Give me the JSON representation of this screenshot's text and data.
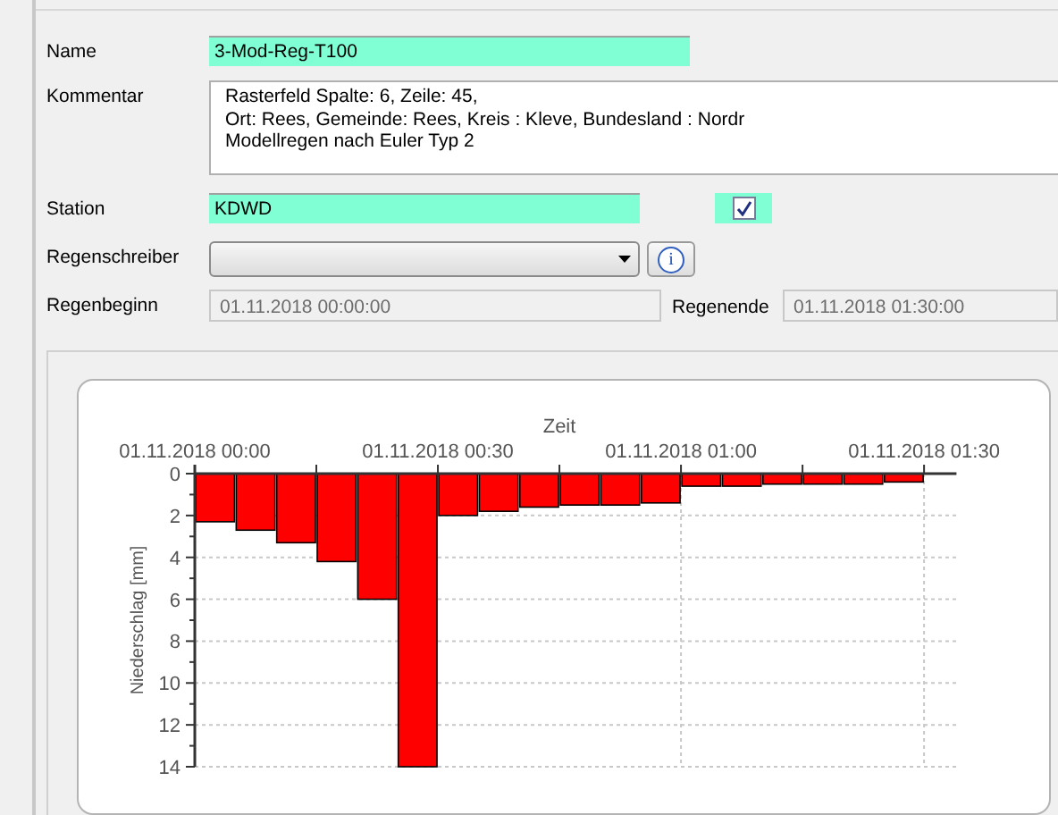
{
  "fields": [
    {
      "kind": "text",
      "label": "Name",
      "value": "3-Mod-Reg-T100",
      "highlighted": true
    },
    {
      "kind": "memo",
      "label": "Kommentar",
      "lines": [
        "Rasterfeld Spalte: 6, Zeile: 45,",
        "Ort: Rees, Gemeinde: Rees, Kreis : Kleve, Bundesland : Nordr",
        "Modellregen nach Euler Typ 2"
      ]
    },
    {
      "kind": "station",
      "label": "Station",
      "value": "KDWD",
      "highlighted": true,
      "checked": true
    },
    {
      "kind": "combo",
      "label": "Regenschreiber",
      "button": "i"
    }
  ],
  "period": {
    "start_label": "Regenbeginn",
    "start": "01.11.2018  00:00:00",
    "end_label": "Regenende",
    "end": "01.11.2018  01:30:00"
  },
  "chart": {
    "chart_data": {
      "type": "bar",
      "xlabel": "Zeit",
      "ylabel": "Niederschlag [mm]",
      "categories": [
        "01.11.2018 00:00",
        null,
        null,
        null,
        null,
        null,
        "01.11.2018 00:30",
        null,
        null,
        null,
        null,
        null,
        "01.11.2018 01:00",
        null,
        null,
        null,
        null,
        null,
        "01.11.2018 01:30"
      ],
      "series": [
        {
          "color": "#ff0000",
          "values": [
            2.3,
            2.7,
            3.3,
            4.2,
            6.0,
            14.0,
            2.0,
            1.8,
            1.6,
            1.5,
            1.5,
            1.4,
            0.6,
            0.6,
            0.5,
            0.5,
            0.5,
            0.4,
            null
          ]
        }
      ],
      "grid": true,
      "ylim": [
        14,
        0
      ],
      "yticks": [
        0,
        2,
        4,
        6,
        8,
        10,
        12,
        14
      ]
    }
  }
}
